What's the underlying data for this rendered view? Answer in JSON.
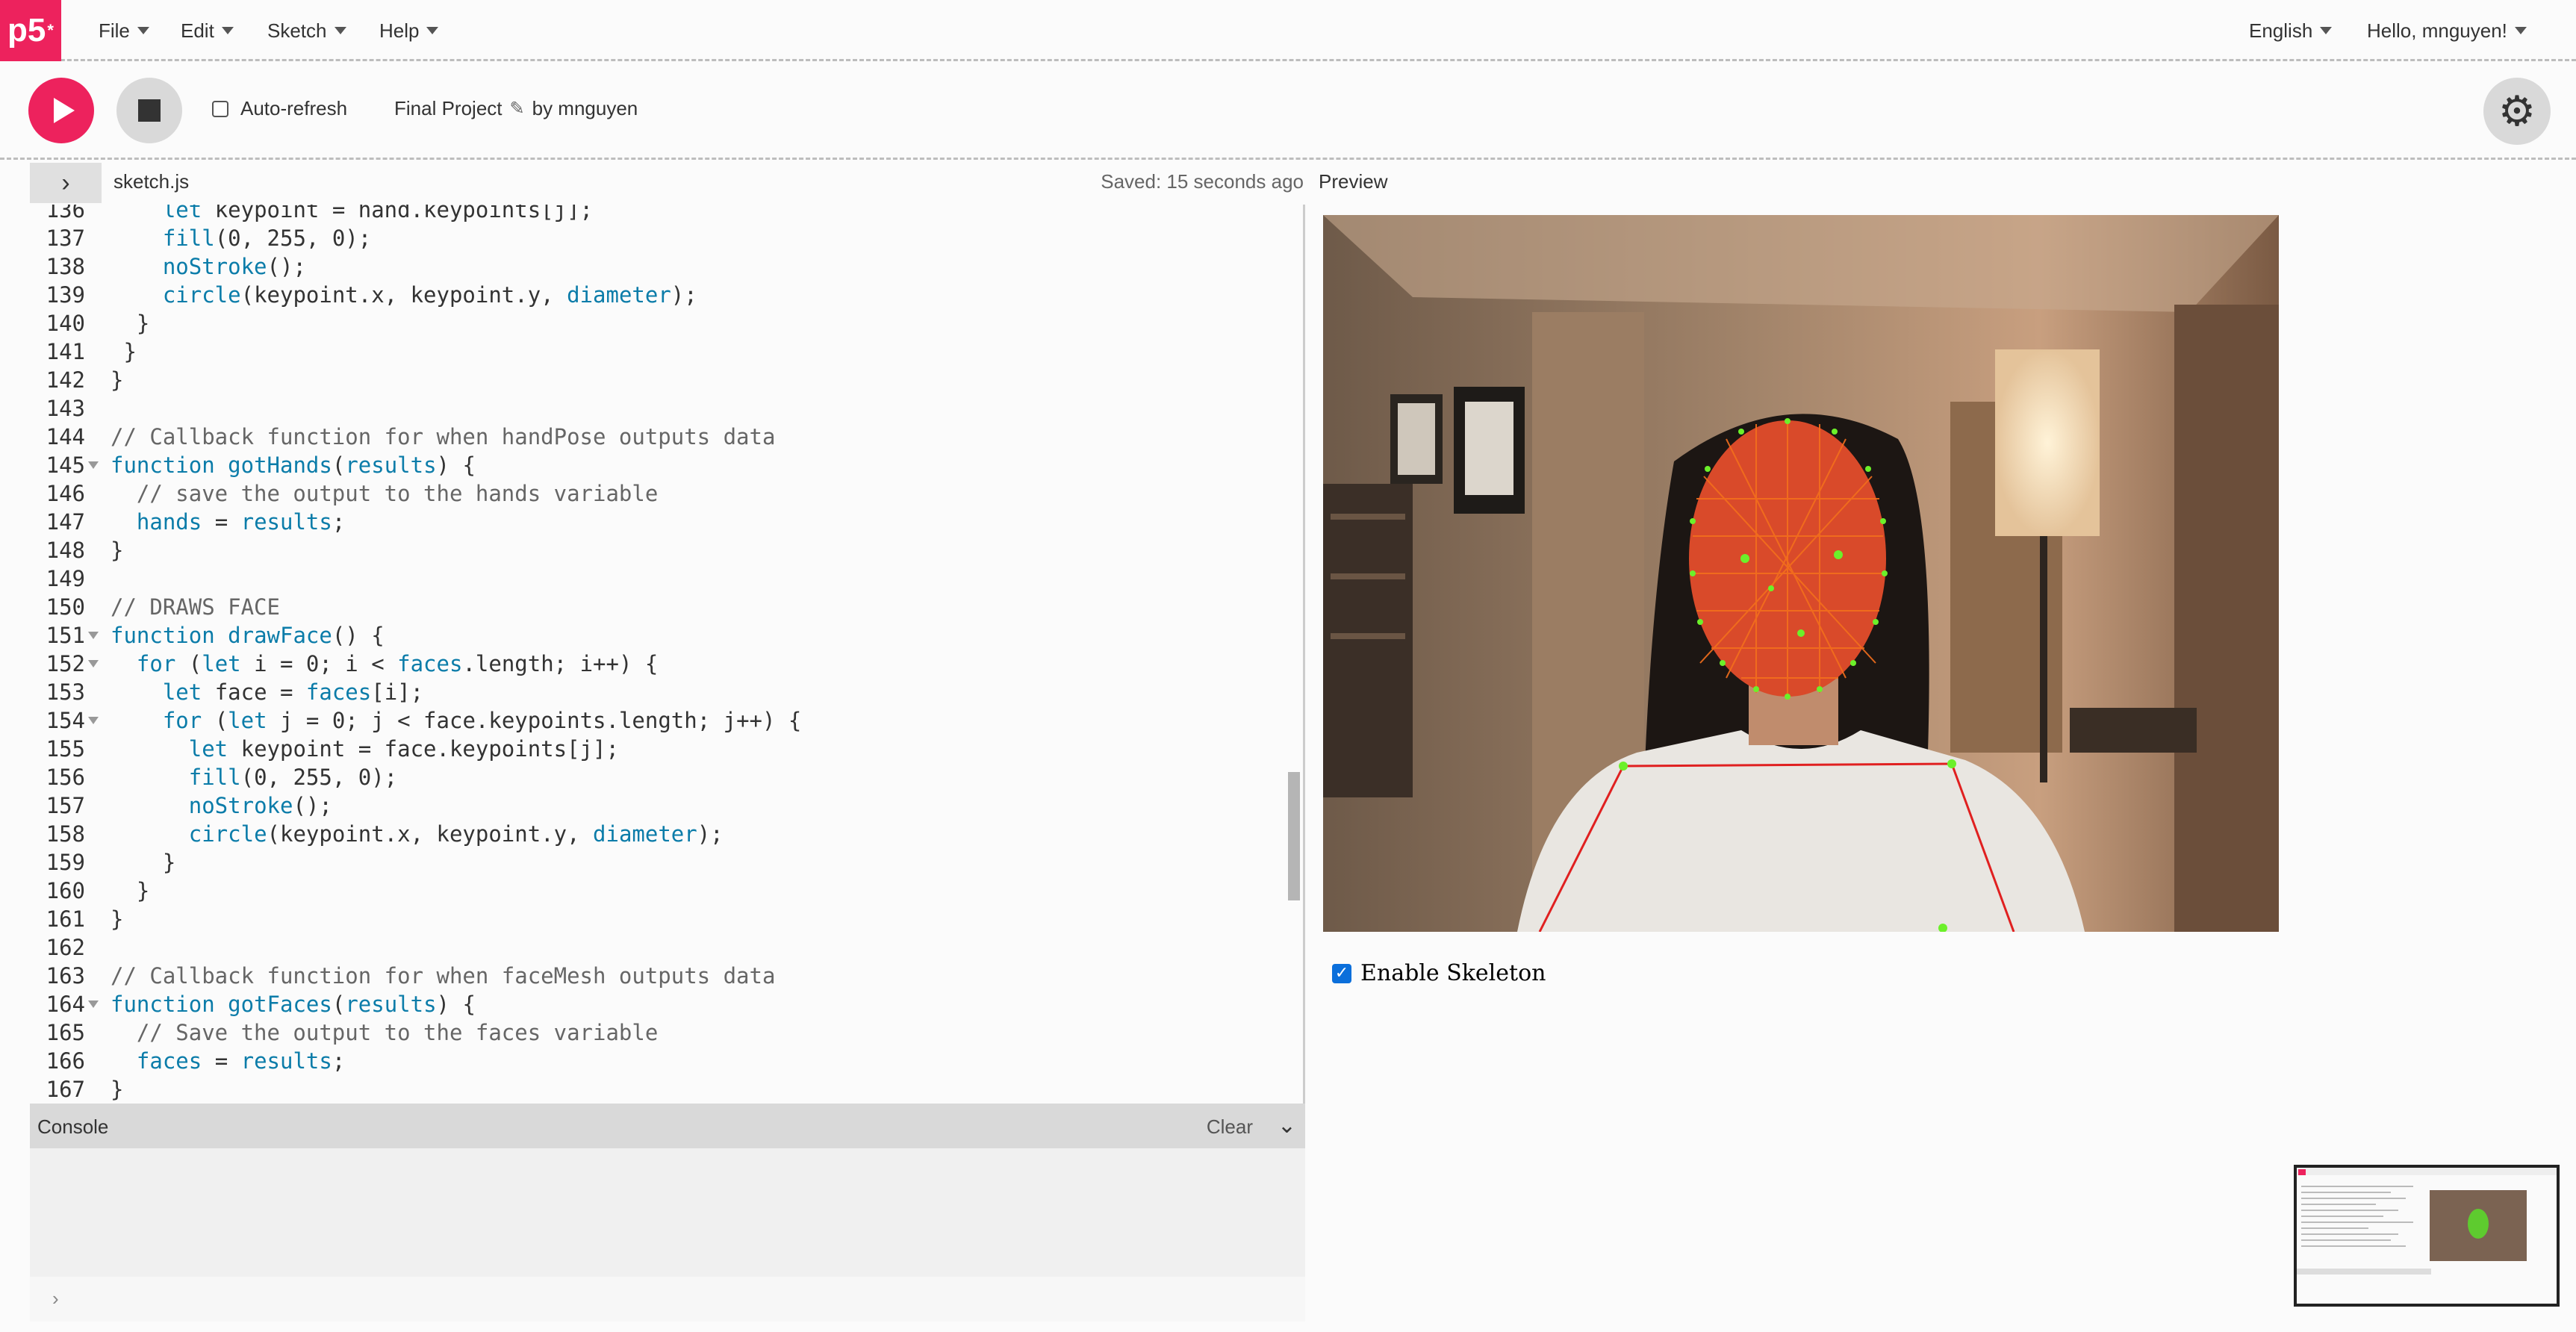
{
  "nav": {
    "logo": "p5",
    "logo_sup": "*",
    "menus": [
      "File",
      "Edit",
      "Sketch",
      "Help"
    ],
    "language": "English",
    "greeting": "Hello, mnguyen!"
  },
  "toolbar": {
    "auto_refresh_label": "Auto-refresh",
    "project_name": "Final Project",
    "by_label": "by mnguyen"
  },
  "editor": {
    "filename": "sketch.js",
    "saved_status": "Saved: 15 seconds ago",
    "preview_label": "Preview",
    "lines": [
      {
        "num": "136",
        "text": "    let keypoint = hand.keypoints[j];"
      },
      {
        "num": "137",
        "text": "    fill(0, 255, 0);"
      },
      {
        "num": "138",
        "text": "    noStroke();"
      },
      {
        "num": "139",
        "text": "    circle(keypoint.x, keypoint.y, diameter);"
      },
      {
        "num": "140",
        "text": "  }"
      },
      {
        "num": "141",
        "text": " }"
      },
      {
        "num": "142",
        "text": "}"
      },
      {
        "num": "143",
        "text": ""
      },
      {
        "num": "144",
        "text": "// Callback function for when handPose outputs data"
      },
      {
        "num": "145",
        "text": "function gotHands(results) {"
      },
      {
        "num": "146",
        "text": "  // save the output to the hands variable"
      },
      {
        "num": "147",
        "text": "  hands = results;"
      },
      {
        "num": "148",
        "text": "}"
      },
      {
        "num": "149",
        "text": ""
      },
      {
        "num": "150",
        "text": "// DRAWS FACE"
      },
      {
        "num": "151",
        "text": "function drawFace() {"
      },
      {
        "num": "152",
        "text": "  for (let i = 0; i < faces.length; i++) {"
      },
      {
        "num": "153",
        "text": "    let face = faces[i];"
      },
      {
        "num": "154",
        "text": "    for (let j = 0; j < face.keypoints.length; j++) {"
      },
      {
        "num": "155",
        "text": "      let keypoint = face.keypoints[j];"
      },
      {
        "num": "156",
        "text": "      fill(0, 255, 0);"
      },
      {
        "num": "157",
        "text": "      noStroke();"
      },
      {
        "num": "158",
        "text": "      circle(keypoint.x, keypoint.y, diameter);"
      },
      {
        "num": "159",
        "text": "    }"
      },
      {
        "num": "160",
        "text": "  }"
      },
      {
        "num": "161",
        "text": "}"
      },
      {
        "num": "162",
        "text": ""
      },
      {
        "num": "163",
        "text": "// Callback function for when faceMesh outputs data"
      },
      {
        "num": "164",
        "text": "function gotFaces(results) {"
      },
      {
        "num": "165",
        "text": "  // Save the output to the faces variable"
      },
      {
        "num": "166",
        "text": "  faces = results;"
      },
      {
        "num": "167",
        "text": "}"
      }
    ]
  },
  "console": {
    "title": "Console",
    "clear_label": "Clear"
  },
  "preview": {
    "enable_skeleton_label": "Enable Skeleton",
    "enable_skeleton_checked": true
  },
  "colors": {
    "accent": "#ed225d",
    "keyword": "#0b7ca9",
    "checkbox": "#0b6fdb"
  }
}
